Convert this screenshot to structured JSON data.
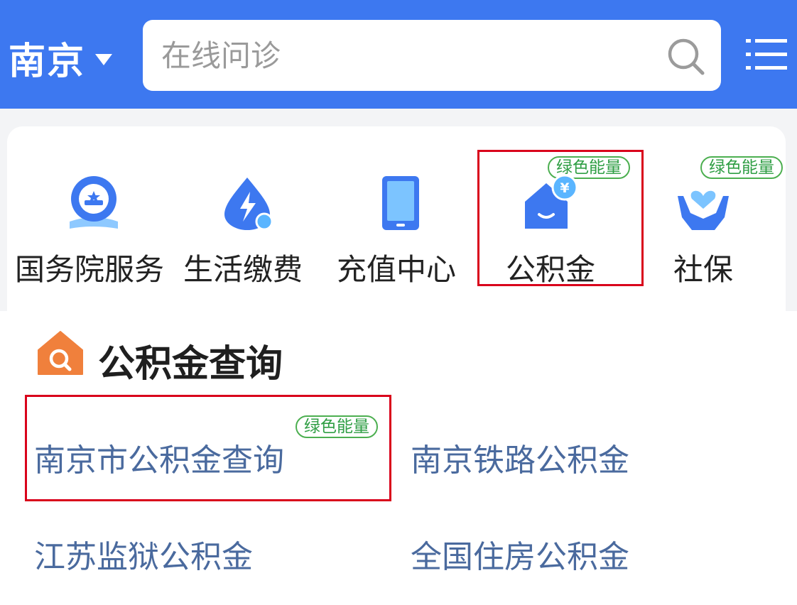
{
  "header": {
    "city": "南京",
    "search": {
      "placeholder": "在线问诊"
    },
    "colors": {
      "background": "#3d78f0",
      "text": "#ffffff"
    }
  },
  "services": [
    {
      "label": "国务院服务",
      "icon": "state-council-icon"
    },
    {
      "label": "生活缴费",
      "icon": "utility-payment-icon"
    },
    {
      "label": "充值中心",
      "icon": "recharge-phone-icon"
    },
    {
      "label": "公积金",
      "icon": "housing-fund-icon",
      "badge": "绿色能量"
    },
    {
      "label": "社保",
      "icon": "social-security-icon",
      "badge": "绿色能量"
    }
  ],
  "section": {
    "title": "公积金查询",
    "icon": "house-search-icon",
    "links": [
      {
        "label": "南京市公积金查询",
        "badge": "绿色能量"
      },
      {
        "label": "南京铁路公积金"
      },
      {
        "label": "江苏监狱公积金"
      },
      {
        "label": "全国住房公积金"
      }
    ]
  },
  "colors": {
    "accent": "#3d78f0",
    "badge_green": "#2f9e44",
    "highlight_red": "#d9001b",
    "link_text": "#4a6a9e",
    "section_icon_orange": "#f0803c"
  }
}
